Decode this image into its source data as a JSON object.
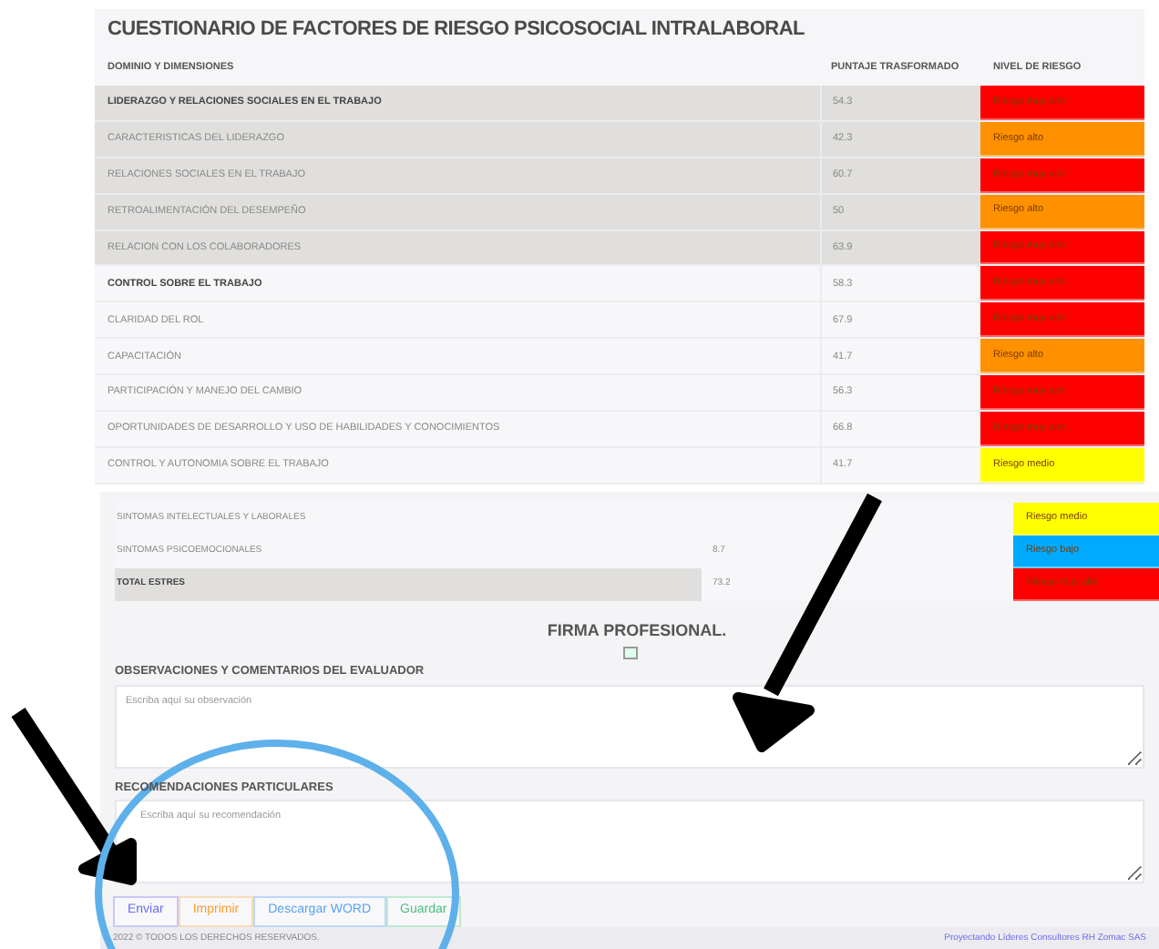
{
  "upper_table": {
    "title": "CUESTIONARIO DE FACTORES DE RIESGO PSICOSOCIAL INTRALABORAL",
    "columns": [
      "DOMINIO Y DIMENSIONES",
      "PUNTAJE TRASFORMADO",
      "NIVEL DE RIESGO"
    ],
    "rows": [
      {
        "kind": "domain",
        "shaded": true,
        "name": "LIDERAZGO Y RELACIONES SOCIALES EN EL TRABAJO",
        "score": "54.3",
        "level": "Riesgo muy alto",
        "color": "#ff0000"
      },
      {
        "kind": "dimension",
        "shaded": true,
        "name": "CARACTERISTICAS DEL LIDERAZGO",
        "score": "42.3",
        "level": "Riesgo alto",
        "color": "#ff9100"
      },
      {
        "kind": "dimension",
        "shaded": true,
        "name": "RELACIONES SOCIALES EN EL TRABAJO",
        "score": "60.7",
        "level": "Riesgo muy alto",
        "color": "#ff0000"
      },
      {
        "kind": "dimension",
        "shaded": true,
        "name": "RETROALIMENTACIÓN DEL DESEMPEÑO",
        "score": "50",
        "level": "Riesgo alto",
        "color": "#ff9100"
      },
      {
        "kind": "dimension",
        "shaded": true,
        "name": "RELACION CON LOS COLABORADORES",
        "score": "63.9",
        "level": "Riesgo muy alto",
        "color": "#ff0000"
      },
      {
        "kind": "domain",
        "shaded": false,
        "name": "CONTROL SOBRE EL TRABAJO",
        "score": "58.3",
        "level": "Riesgo muy alto",
        "color": "#ff0000"
      },
      {
        "kind": "dimension",
        "shaded": false,
        "name": "CLARIDAD DEL ROL",
        "score": "67.9",
        "level": "Riesgo muy alto",
        "color": "#ff0000"
      },
      {
        "kind": "dimension",
        "shaded": false,
        "name": "CAPACITACIÓN",
        "score": "41.7",
        "level": "Riesgo alto",
        "color": "#ff9100"
      },
      {
        "kind": "dimension",
        "shaded": false,
        "name": "PARTICIPACIÓN Y MANEJO DEL CAMBIO",
        "score": "56.3",
        "level": "Riesgo muy alto",
        "color": "#ff0000"
      },
      {
        "kind": "dimension",
        "shaded": false,
        "name": "OPORTUNIDADES DE DESARROLLO Y USO DE HABILIDADES Y CONOCIMIENTOS",
        "score": "66.8",
        "level": "Riesgo muy alto",
        "color": "#ff0000"
      },
      {
        "kind": "dimension",
        "shaded": false,
        "name": "CONTROL Y AUTONOMIA SOBRE EL TRABAJO",
        "score": "41.7",
        "level": "Riesgo medio",
        "color": "#ffff00"
      }
    ]
  },
  "lower_page": {
    "rows": [
      {
        "kind": "dimension",
        "name": "SINTOMAS INTELECTUALES Y LABORALES",
        "level": "Riesgo medio",
        "color": "#ffff00"
      },
      {
        "kind": "dimension",
        "name": "SINTOMAS PSICOEMOCIONALES",
        "score": "8.7",
        "level": "Riesgo bajo",
        "color": "#00aaff"
      },
      {
        "kind": "total",
        "name": "TOTAL ESTRES",
        "score": "73.2",
        "level": "Riesgo muy alto",
        "color": "#ff0000"
      }
    ],
    "signature_title": "FIRMA PROFESIONAL.",
    "observations": {
      "label": "OBSERVACIONES Y COMENTARIOS DEL EVALUADOR",
      "placeholder": "Escriba aquí su observación"
    },
    "recommendations": {
      "label": "RECOMENDACIONES PARTICULARES",
      "placeholder": "Escriba aquí su recomendación"
    },
    "buttons": [
      {
        "label": "Enviar",
        "kind": "primary"
      },
      {
        "label": "Imprimir",
        "kind": "warning"
      },
      {
        "label": "Descargar WORD",
        "kind": "info"
      },
      {
        "label": "Guardar",
        "kind": "success"
      }
    ],
    "footer": {
      "copyright": "2022 © TODOS LOS DERECHOS RESERVADOS.",
      "credit": "Proyectando Líderes Consultores RH Zomac SAS"
    }
  }
}
